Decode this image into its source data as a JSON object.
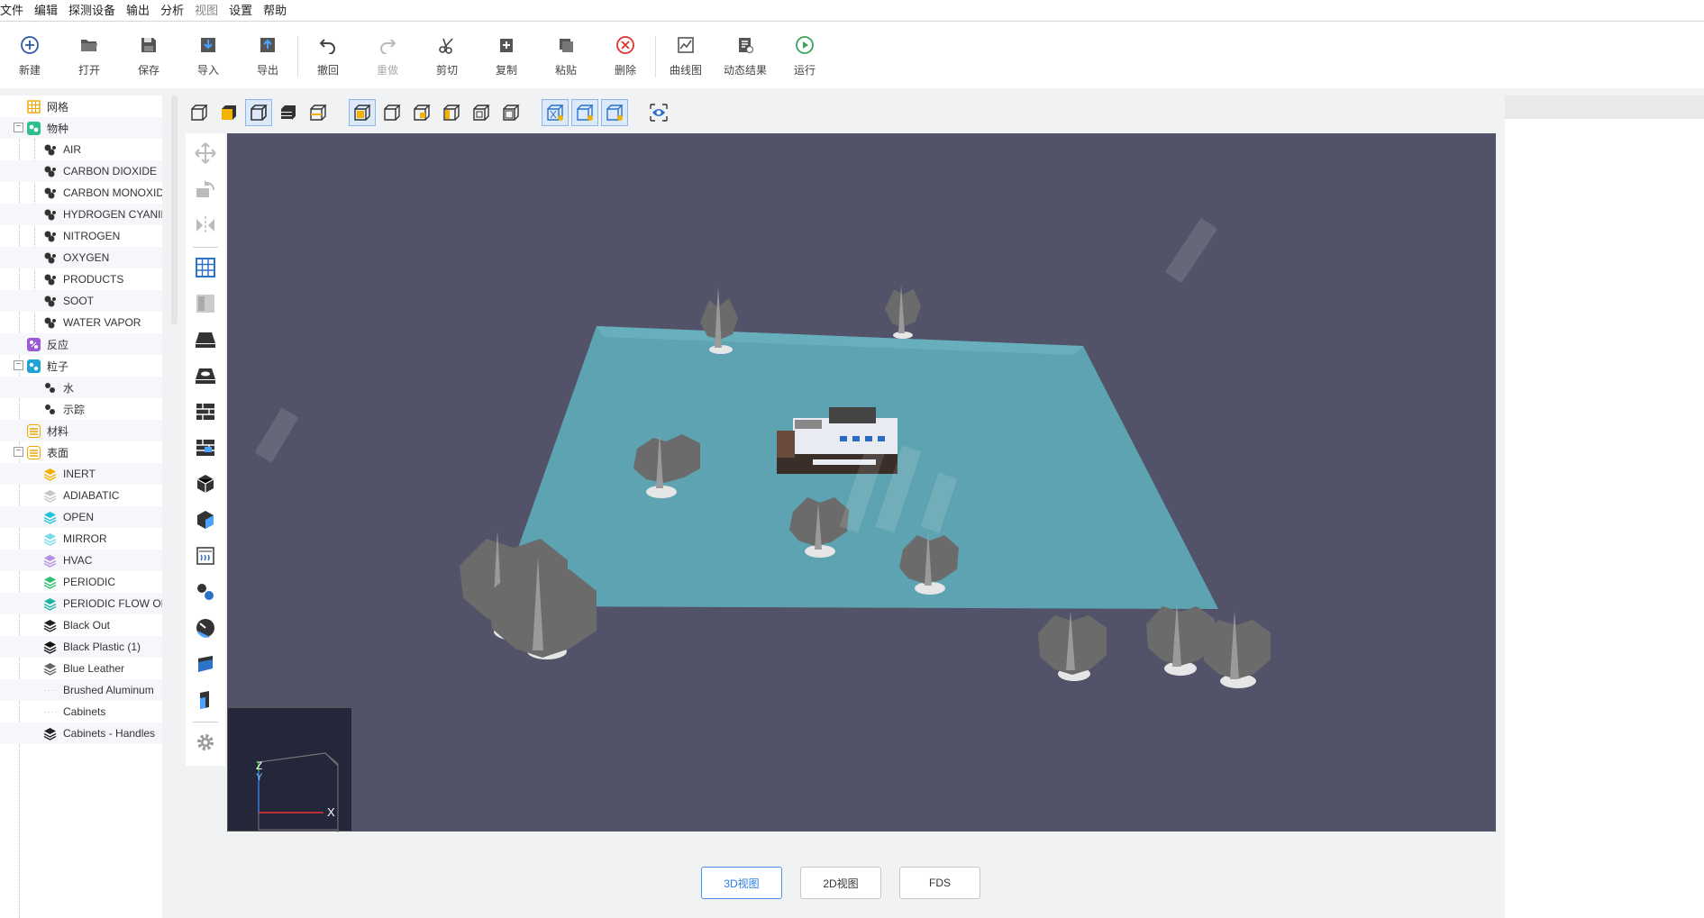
{
  "menu": [
    "文件",
    "编辑",
    "探测设备",
    "输出",
    "分析",
    "视图",
    "设置",
    "帮助"
  ],
  "toolbar": {
    "new": "新建",
    "open": "打开",
    "save": "保存",
    "import": "导入",
    "export": "导出",
    "undo": "撤回",
    "redo": "重做",
    "cut": "剪切",
    "copy": "复制",
    "paste": "粘贴",
    "delete": "删除",
    "curve": "曲线图",
    "dynamic": "动态结果",
    "run": "运行"
  },
  "tree": {
    "grid": "网格",
    "species": "物种",
    "species_items": [
      "AIR",
      "CARBON DIOXIDE",
      "CARBON MONOXID",
      "HYDROGEN CYANID",
      "NITROGEN",
      "OXYGEN",
      "PRODUCTS",
      "SOOT",
      "WATER VAPOR"
    ],
    "reaction": "反应",
    "particles": "粒子",
    "particle_items": [
      "水",
      "示踪"
    ],
    "materials": "材料",
    "surfaces": "表面",
    "surface_items": [
      "INERT",
      "ADIABATIC",
      "OPEN",
      "MIRROR",
      "HVAC",
      "PERIODIC",
      "PERIODIC FLOW ON",
      "Black Out",
      "Black Plastic (1)",
      "Blue Leather",
      "Brushed Aluminum",
      "Cabinets",
      "Cabinets - Handles"
    ]
  },
  "axis": {
    "x": "X",
    "y": "Y",
    "z": "Z"
  },
  "tabs": [
    "3D视图",
    "2D视图",
    "FDS"
  ],
  "colors": {
    "viewport_bg": "#525368",
    "ground": "#5fa8b5",
    "accent": "#2c7be5"
  }
}
